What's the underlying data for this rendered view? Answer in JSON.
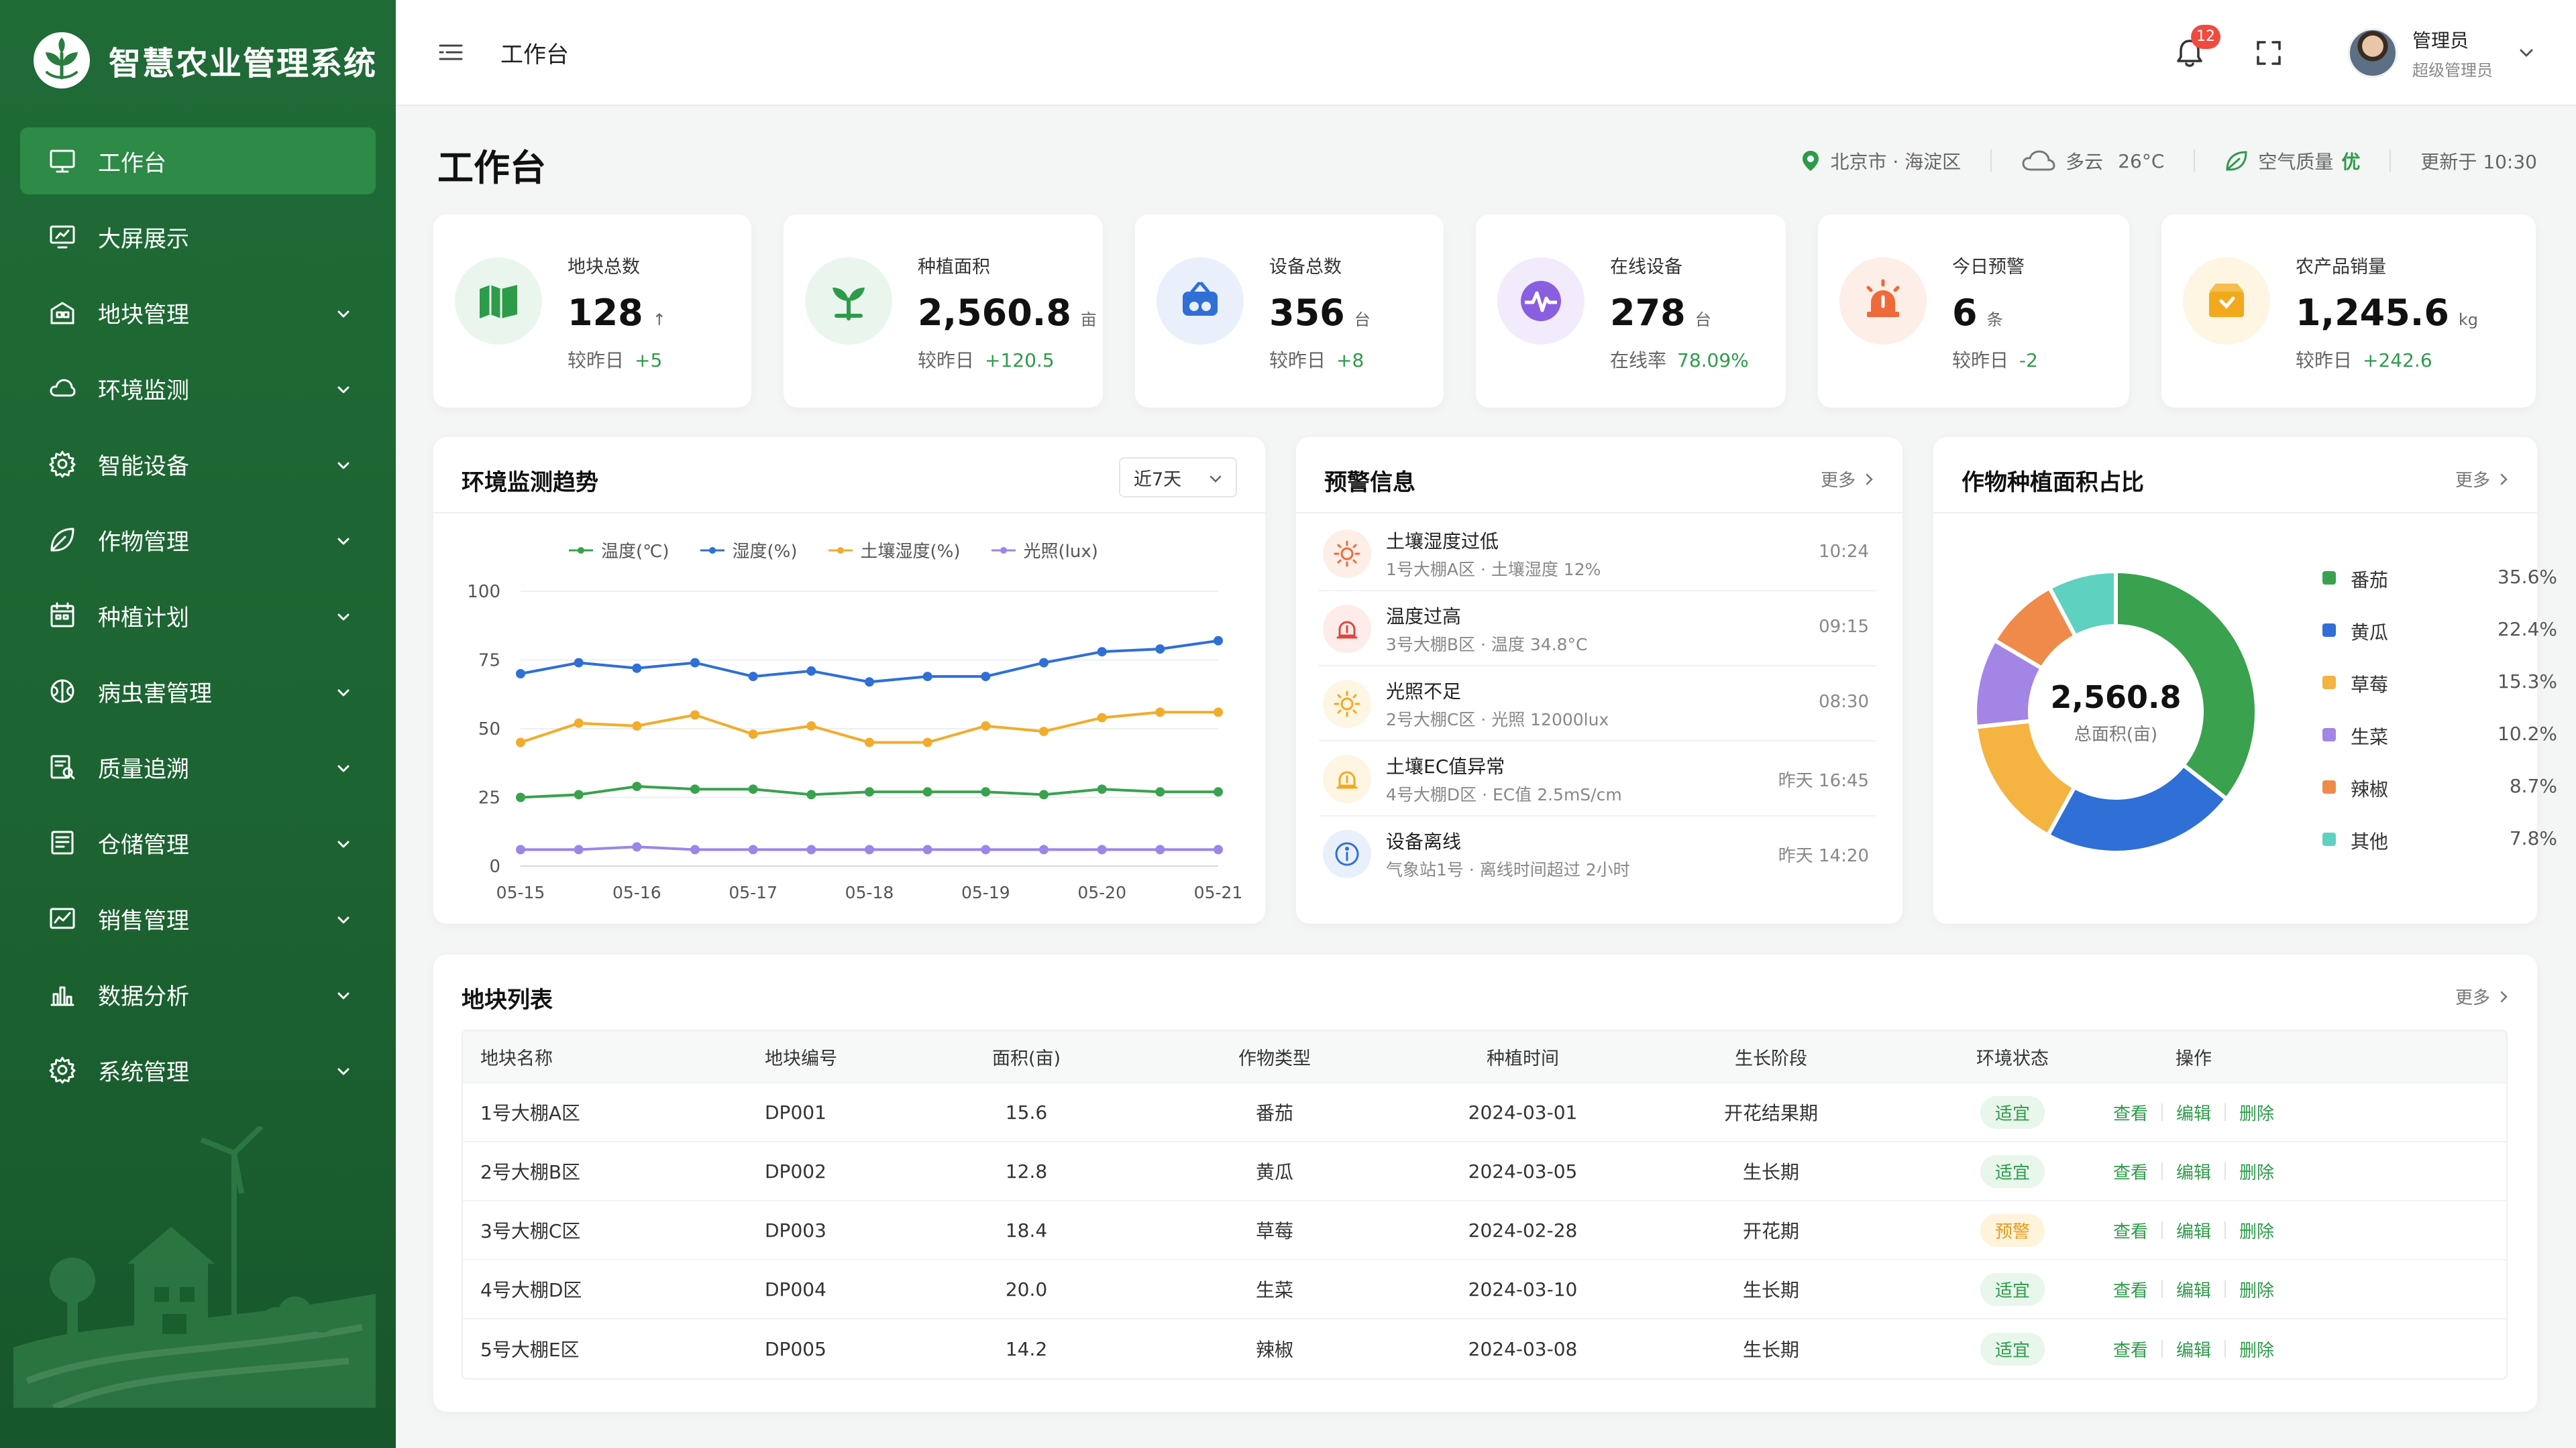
{
  "app": {
    "title": "智慧农业管理系统"
  },
  "sidebar": {
    "items": [
      {
        "label": "工作台",
        "icon": "monitor-icon",
        "active": true,
        "expandable": false
      },
      {
        "label": "大屏展示",
        "icon": "display-icon",
        "active": false,
        "expandable": false
      },
      {
        "label": "地块管理",
        "icon": "land-icon",
        "active": false,
        "expandable": true
      },
      {
        "label": "环境监测",
        "icon": "cloud-icon",
        "active": false,
        "expandable": true
      },
      {
        "label": "智能设备",
        "icon": "gear-icon",
        "active": false,
        "expandable": true
      },
      {
        "label": "作物管理",
        "icon": "leaf-icon",
        "active": false,
        "expandable": true
      },
      {
        "label": "种植计划",
        "icon": "calendar-icon",
        "active": false,
        "expandable": true
      },
      {
        "label": "病虫害管理",
        "icon": "pest-icon",
        "active": false,
        "expandable": true
      },
      {
        "label": "质量追溯",
        "icon": "trace-icon",
        "active": false,
        "expandable": true
      },
      {
        "label": "仓储管理",
        "icon": "warehouse-icon",
        "active": false,
        "expandable": true
      },
      {
        "label": "销售管理",
        "icon": "sales-icon",
        "active": false,
        "expandable": true
      },
      {
        "label": "数据分析",
        "icon": "bar-chart-icon",
        "active": false,
        "expandable": true
      },
      {
        "label": "系统管理",
        "icon": "settings-icon",
        "active": false,
        "expandable": true
      }
    ]
  },
  "topbar": {
    "breadcrumb": "工作台",
    "notification_count": "12",
    "user_name": "管理员",
    "user_role": "超级管理员"
  },
  "header": {
    "title": "工作台",
    "location": "北京市 · 海淀区",
    "weather": "多云",
    "temperature": "26°C",
    "air_quality_label": "空气质量",
    "air_quality_value": "优",
    "updated": "更新于 10:30"
  },
  "stats": [
    {
      "label": "地块总数",
      "value": "128",
      "unit": "",
      "trend_arrow": "↑",
      "sub_label": "较昨日",
      "sub_value": "+5",
      "icon": "map-icon",
      "color": "#2e9b4a",
      "bg": "#eaf6ed"
    },
    {
      "label": "种植面积",
      "value": "2,560.8",
      "unit": "亩",
      "trend_arrow": "",
      "sub_label": "较昨日",
      "sub_value": "+120.5",
      "icon": "sprout-icon",
      "color": "#2e9b4a",
      "bg": "#eaf6ed"
    },
    {
      "label": "设备总数",
      "value": "356",
      "unit": "台",
      "trend_arrow": "",
      "sub_label": "较昨日",
      "sub_value": "+8",
      "icon": "device-icon",
      "color": "#2f6fd6",
      "bg": "#e9f0fb"
    },
    {
      "label": "在线设备",
      "value": "278",
      "unit": "台",
      "trend_arrow": "",
      "sub_label": "在线率",
      "sub_value": "78.09%",
      "icon": "pulse-icon",
      "color": "#8a5ee0",
      "bg": "#f1ebfc"
    },
    {
      "label": "今日预警",
      "value": "6",
      "unit": "条",
      "trend_arrow": "",
      "sub_label": "较昨日",
      "sub_value": "-2",
      "icon": "alarm-icon",
      "color": "#ef6a3a",
      "bg": "#fdeee7"
    },
    {
      "label": "农产品销量",
      "value": "1,245.6",
      "unit": "kg",
      "trend_arrow": "",
      "sub_label": "较昨日",
      "sub_value": "+242.6",
      "icon": "box-icon",
      "color": "#f2a91e",
      "bg": "#fef5e3"
    }
  ],
  "trend": {
    "title": "环境监测趋势",
    "range": "近7天"
  },
  "chart_data": {
    "type": "line",
    "x": [
      "05-15",
      "",
      "05-16",
      "",
      "05-17",
      "",
      "05-18",
      "",
      "05-19",
      "",
      "05-20",
      "",
      "05-21"
    ],
    "ylim": [
      0,
      100
    ],
    "yticks": [
      0,
      25,
      50,
      75,
      100
    ],
    "series": [
      {
        "name": "温度(℃)",
        "color": "#3aa14f",
        "values": [
          25,
          26,
          29,
          28,
          28,
          26,
          27,
          27,
          27,
          26,
          28,
          27,
          27
        ]
      },
      {
        "name": "湿度(%)",
        "color": "#2f6fd6",
        "values": [
          70,
          74,
          72,
          74,
          69,
          71,
          67,
          69,
          69,
          74,
          78,
          79,
          82
        ]
      },
      {
        "name": "土壤湿度(%)",
        "color": "#f2ac2c",
        "values": [
          45,
          52,
          51,
          55,
          48,
          51,
          45,
          45,
          51,
          49,
          54,
          56,
          56
        ]
      },
      {
        "name": "光照(lux)",
        "color": "#9b86e8",
        "values": [
          6,
          6,
          7,
          6,
          6,
          6,
          6,
          6,
          6,
          6,
          6,
          6,
          6
        ]
      }
    ]
  },
  "alerts": {
    "title": "预警信息",
    "more": "更多",
    "items": [
      {
        "title": "土壤湿度过低",
        "desc": "1号大棚A区 · 土壤湿度 12%",
        "time": "10:24",
        "icon": "sun-warning-icon",
        "color": "#ef6a3a",
        "bg": "#fdeee7"
      },
      {
        "title": "温度过高",
        "desc": "3号大棚B区 · 温度 34.8°C",
        "time": "09:15",
        "icon": "alarm-icon",
        "color": "#e0453a",
        "bg": "#fdecea"
      },
      {
        "title": "光照不足",
        "desc": "2号大棚C区 · 光照 12000lux",
        "time": "08:30",
        "icon": "sun-icon",
        "color": "#f2a91e",
        "bg": "#fef5e3"
      },
      {
        "title": "土壤EC值异常",
        "desc": "4号大棚D区 · EC值 2.5mS/cm",
        "time": "昨天 16:45",
        "icon": "alarm-icon",
        "color": "#f2a91e",
        "bg": "#fef5e3"
      },
      {
        "title": "设备离线",
        "desc": "气象站1号 · 离线时间超过 2小时",
        "time": "昨天 14:20",
        "icon": "info-icon",
        "color": "#2f6fd6",
        "bg": "#e9f0fb"
      }
    ]
  },
  "crops": {
    "title": "作物种植面积占比",
    "more": "更多",
    "center_value": "2,560.8",
    "center_label": "总面积(亩)",
    "slices": [
      {
        "name": "番茄",
        "pct_label": "35.6%",
        "value": 35.6,
        "color": "#3aa14f"
      },
      {
        "name": "黄瓜",
        "pct_label": "22.4%",
        "value": 22.4,
        "color": "#2f6fd6"
      },
      {
        "name": "草莓",
        "pct_label": "15.3%",
        "value": 15.3,
        "color": "#f5b342"
      },
      {
        "name": "生菜",
        "pct_label": "10.2%",
        "value": 10.2,
        "color": "#a385e6"
      },
      {
        "name": "辣椒",
        "pct_label": "8.7%",
        "value": 8.7,
        "color": "#f08a4b"
      },
      {
        "name": "其他",
        "pct_label": "7.8%",
        "value": 7.8,
        "color": "#5fd1c1"
      }
    ]
  },
  "plots": {
    "title": "地块列表",
    "more": "更多",
    "headers": [
      "地块名称",
      "地块编号",
      "面积(亩)",
      "作物类型",
      "种植时间",
      "生长阶段",
      "环境状态",
      "操作"
    ],
    "rows": [
      {
        "name": "1号大棚A区",
        "code": "DP001",
        "area": "15.6",
        "crop": "番茄",
        "date": "2024-03-01",
        "stage": "开花结果期",
        "status": "适宜",
        "status_type": "ok"
      },
      {
        "name": "2号大棚B区",
        "code": "DP002",
        "area": "12.8",
        "crop": "黄瓜",
        "date": "2024-03-05",
        "stage": "生长期",
        "status": "适宜",
        "status_type": "ok"
      },
      {
        "name": "3号大棚C区",
        "code": "DP003",
        "area": "18.4",
        "crop": "草莓",
        "date": "2024-02-28",
        "stage": "开花期",
        "status": "预警",
        "status_type": "warn"
      },
      {
        "name": "4号大棚D区",
        "code": "DP004",
        "area": "20.0",
        "crop": "生菜",
        "date": "2024-03-10",
        "stage": "生长期",
        "status": "适宜",
        "status_type": "ok"
      },
      {
        "name": "5号大棚E区",
        "code": "DP005",
        "area": "14.2",
        "crop": "辣椒",
        "date": "2024-03-08",
        "stage": "生长期",
        "status": "适宜",
        "status_type": "ok"
      }
    ],
    "actions": {
      "view": "查看",
      "edit": "编辑",
      "delete": "删除"
    }
  }
}
